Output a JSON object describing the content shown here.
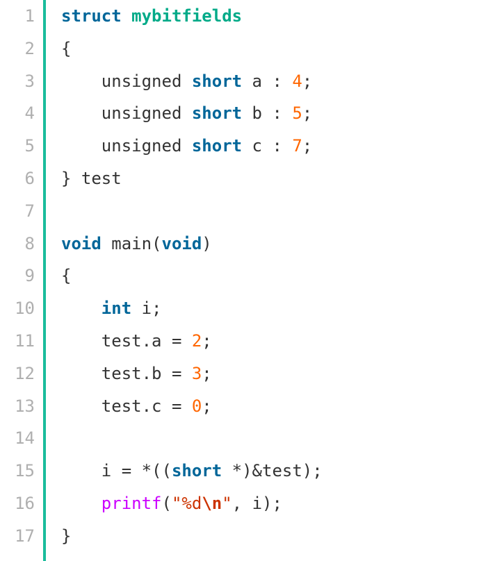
{
  "lang": "c",
  "gutter": [
    "1",
    "2",
    "3",
    "4",
    "5",
    "6",
    "7",
    "8",
    "9",
    "10",
    "11",
    "12",
    "13",
    "14",
    "15",
    "16",
    "17"
  ],
  "lines": [
    [
      [
        "kw-struct",
        "struct"
      ],
      [
        "txt",
        " "
      ],
      [
        "classname",
        "mybitfields"
      ]
    ],
    [
      [
        "txt",
        "{"
      ]
    ],
    [
      [
        "txt",
        "    unsigned "
      ],
      [
        "kw-short",
        "short"
      ],
      [
        "txt",
        " a : "
      ],
      [
        "num",
        "4"
      ],
      [
        "txt",
        ";"
      ]
    ],
    [
      [
        "txt",
        "    unsigned "
      ],
      [
        "kw-short",
        "short"
      ],
      [
        "txt",
        " b : "
      ],
      [
        "num",
        "5"
      ],
      [
        "txt",
        ";"
      ]
    ],
    [
      [
        "txt",
        "    unsigned "
      ],
      [
        "kw-short",
        "short"
      ],
      [
        "txt",
        " c : "
      ],
      [
        "num",
        "7"
      ],
      [
        "txt",
        ";"
      ]
    ],
    [
      [
        "txt",
        "} test"
      ]
    ],
    [],
    [
      [
        "kw-void",
        "void"
      ],
      [
        "txt",
        " main("
      ],
      [
        "kw-void",
        "void"
      ],
      [
        "txt",
        ")"
      ]
    ],
    [
      [
        "txt",
        "{"
      ]
    ],
    [
      [
        "txt",
        "    "
      ],
      [
        "kw-int",
        "int"
      ],
      [
        "txt",
        " i;"
      ]
    ],
    [
      [
        "txt",
        "    test.a = "
      ],
      [
        "num",
        "2"
      ],
      [
        "txt",
        ";"
      ]
    ],
    [
      [
        "txt",
        "    test.b = "
      ],
      [
        "num",
        "3"
      ],
      [
        "txt",
        ";"
      ]
    ],
    [
      [
        "txt",
        "    test.c = "
      ],
      [
        "num",
        "0"
      ],
      [
        "txt",
        ";"
      ]
    ],
    [],
    [
      [
        "txt",
        "    i = *(("
      ],
      [
        "kw-short",
        "short"
      ],
      [
        "txt",
        " *)&test);"
      ]
    ],
    [
      [
        "txt",
        "    "
      ],
      [
        "fn",
        "printf"
      ],
      [
        "txt",
        "("
      ],
      [
        "str",
        "\"%d"
      ],
      [
        "esc",
        "\\n"
      ],
      [
        "str",
        "\""
      ],
      [
        "txt",
        ", i);"
      ]
    ],
    [
      [
        "txt",
        "}"
      ]
    ]
  ]
}
